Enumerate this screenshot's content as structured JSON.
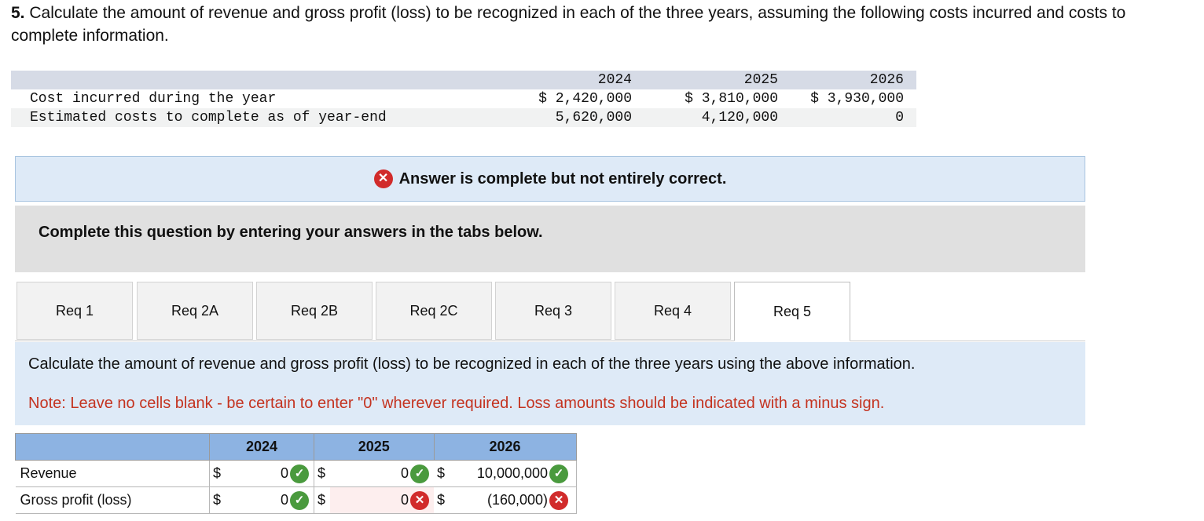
{
  "question": {
    "number": "5.",
    "text": "Calculate the amount of revenue and gross profit (loss) to be recognized in each of the three years, assuming the following costs incurred and costs to complete information."
  },
  "info_table": {
    "years": [
      "2024",
      "2025",
      "2026"
    ],
    "rows": [
      {
        "label": "Cost incurred during the year",
        "values": [
          "$ 2,420,000",
          "$ 3,810,000",
          "$ 3,930,000"
        ]
      },
      {
        "label": "Estimated costs to complete as of year-end",
        "values": [
          "5,620,000",
          "4,120,000",
          "0"
        ]
      }
    ]
  },
  "banner": {
    "text": "Answer is complete but not entirely correct.",
    "icon": "x-circle-icon"
  },
  "instruction": "Complete this question by entering your answers in the tabs below.",
  "tabs": [
    "Req 1",
    "Req 2A",
    "Req 2B",
    "Req 2C",
    "Req 3",
    "Req 4",
    "Req 5"
  ],
  "active_tab": "Req 5",
  "req_text": {
    "main": "Calculate the amount of revenue and gross profit (loss) to be recognized in each of the three years using the above information.",
    "note": "Note: Leave no cells blank - be certain to enter \"0\" wherever required. Loss amounts should be indicated with a minus sign."
  },
  "answer_table": {
    "years": [
      "2024",
      "2025",
      "2026"
    ],
    "rows": [
      {
        "label": "Revenue",
        "cells": [
          {
            "currency": "$",
            "value": "0",
            "status": "correct"
          },
          {
            "currency": "$",
            "value": "0",
            "status": "correct"
          },
          {
            "currency": "$",
            "value": "10,000,000",
            "status": "correct"
          }
        ]
      },
      {
        "label": "Gross profit (loss)",
        "cells": [
          {
            "currency": "$",
            "value": "0",
            "status": "correct"
          },
          {
            "currency": "$",
            "value": "0",
            "status": "incorrect"
          },
          {
            "currency": "$",
            "value": "(160,000)",
            "status": "incorrect"
          }
        ]
      }
    ]
  },
  "colors": {
    "correct": "#4a9a3e",
    "incorrect": "#d12b2b",
    "header_blue": "#8db3e2",
    "note_red": "#c43320"
  }
}
